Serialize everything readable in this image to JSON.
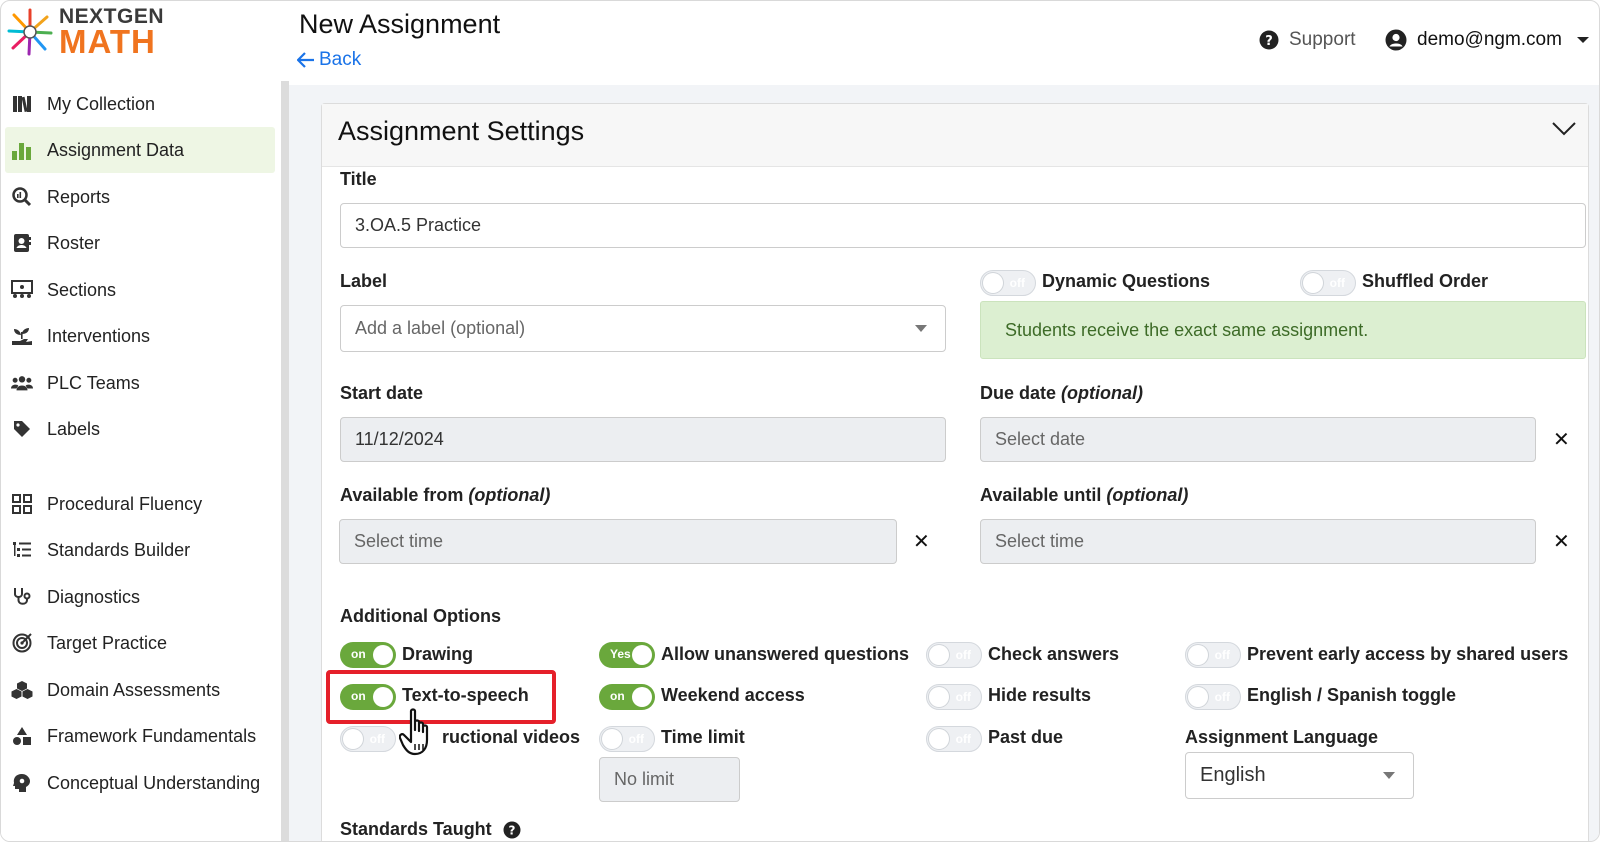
{
  "app": {
    "logo_top": "NEXTGEN",
    "logo_bottom": "MATH"
  },
  "header": {
    "title": "New Assignment",
    "back": "Back",
    "support": "Support",
    "user_email": "demo@ngm.com"
  },
  "sidebar": {
    "items": [
      {
        "label": "My Collection",
        "icon": "books-icon"
      },
      {
        "label": "Assignment Data",
        "icon": "bar-chart-icon",
        "active": true
      },
      {
        "label": "Reports",
        "icon": "magnify-chart-icon"
      },
      {
        "label": "Roster",
        "icon": "contact-book-icon"
      },
      {
        "label": "Sections",
        "icon": "sections-icon"
      },
      {
        "label": "Interventions",
        "icon": "hand-plant-icon"
      },
      {
        "label": "PLC Teams",
        "icon": "users-icon"
      },
      {
        "label": "Labels",
        "icon": "tag-icon"
      },
      {
        "label": "Procedural Fluency",
        "icon": "grid-icon"
      },
      {
        "label": "Standards Builder",
        "icon": "list-tree-icon"
      },
      {
        "label": "Diagnostics",
        "icon": "stethoscope-icon"
      },
      {
        "label": "Target Practice",
        "icon": "target-icon"
      },
      {
        "label": "Domain Assessments",
        "icon": "cubes-icon"
      },
      {
        "label": "Framework Fundamentals",
        "icon": "shapes-icon"
      },
      {
        "label": "Conceptual Understanding",
        "icon": "head-idea-icon"
      }
    ]
  },
  "settings": {
    "heading": "Assignment Settings",
    "title_label": "Title",
    "title_value": "3.OA.5 Practice",
    "label_label": "Label",
    "label_placeholder": "Add a label (optional)",
    "dynamic_questions": {
      "label": "Dynamic Questions",
      "state": "off"
    },
    "shuffled_order": {
      "label": "Shuffled Order",
      "state": "off"
    },
    "notice": "Students receive the exact same assignment.",
    "start_date_label": "Start date",
    "start_date_value": "11/12/2024",
    "due_date_label": "Due date",
    "due_date_optional": "(optional)",
    "due_date_placeholder": "Select date",
    "available_from_label": "Available from",
    "available_from_optional": "(optional)",
    "available_from_placeholder": "Select time",
    "available_until_label": "Available until",
    "available_until_optional": "(optional)",
    "available_until_placeholder": "Select time",
    "clear_symbol": "✕",
    "additional_options_label": "Additional Options",
    "options": {
      "drawing": {
        "label": "Drawing",
        "state": "on"
      },
      "text_to_speech": {
        "label": "Text-to-speech",
        "state": "on"
      },
      "instructional_videos": {
        "label": "ructional videos",
        "state": "off"
      },
      "allow_unanswered": {
        "label": "Allow unanswered questions",
        "state": "Yes"
      },
      "weekend_access": {
        "label": "Weekend access",
        "state": "on"
      },
      "time_limit": {
        "label": "Time limit",
        "state": "off"
      },
      "check_answers": {
        "label": "Check answers",
        "state": "off"
      },
      "hide_results": {
        "label": "Hide results",
        "state": "off"
      },
      "past_due": {
        "label": "Past due",
        "state": "off"
      },
      "prevent_early_access": {
        "label": "Prevent early access by shared users",
        "state": "off"
      },
      "english_spanish": {
        "label": "English / Spanish toggle",
        "state": "off"
      }
    },
    "time_limit_value": "No limit",
    "assignment_language_label": "Assignment Language",
    "assignment_language_value": "English",
    "standards_taught_label": "Standards Taught"
  },
  "colors": {
    "accent_green": "#6aa83c",
    "link_blue": "#1a73e8",
    "highlight_red": "#e5202a"
  }
}
